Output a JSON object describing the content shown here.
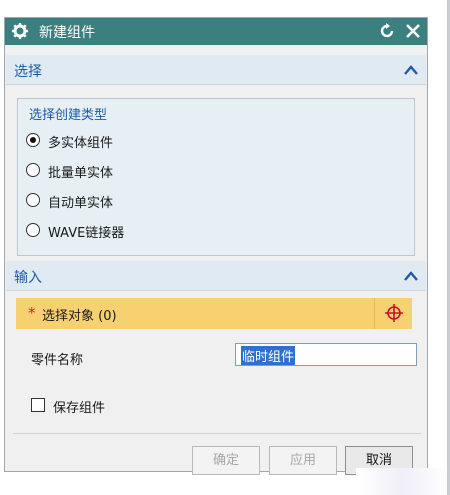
{
  "dialog": {
    "title": "新建组件",
    "title_bar_color": "#3b7f7e",
    "icons": [
      "gear-icon",
      "reset-icon",
      "close-icon"
    ]
  },
  "select_section": {
    "header": "选择",
    "group_label": "选择创建类型",
    "options": [
      {
        "label": "多实体组件",
        "selected": true
      },
      {
        "label": "批量单实体",
        "selected": false
      },
      {
        "label": "自动单实体",
        "selected": false
      },
      {
        "label": "WAVE链接器",
        "selected": false
      }
    ]
  },
  "input_section": {
    "header": "输入",
    "select_object": {
      "required_mark": "*",
      "label": "选择对象 (0)",
      "icon": "crosshair-icon"
    },
    "part_name_label": "零件名称",
    "part_name_value": "临时组件",
    "save_component": {
      "label": "保存组件",
      "checked": false
    }
  },
  "footer": {
    "ok": "确定",
    "apply": "应用",
    "cancel": "取消"
  },
  "colors": {
    "section_header_bg": "#dfeaf2",
    "accent_text": "#1f5aa6",
    "selection_bar": "#f7d06f"
  }
}
